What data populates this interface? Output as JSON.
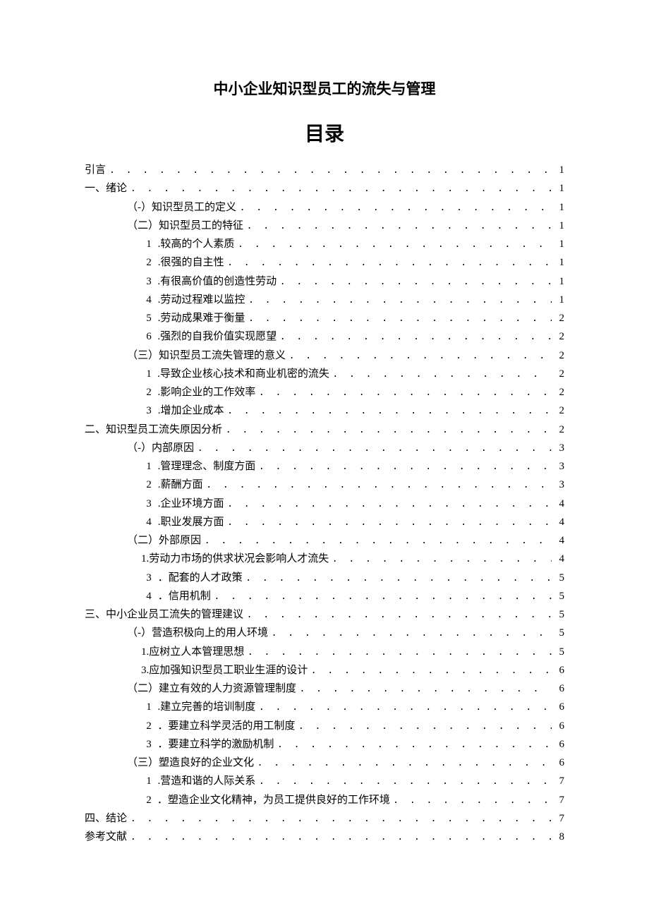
{
  "title": "中小企业知识型员工的流失与管理",
  "toc_heading": "目录",
  "entries": [
    {
      "indent": 0,
      "num": "",
      "label": "引言",
      "page": "1"
    },
    {
      "indent": 0,
      "num": "",
      "label": "一、绪论",
      "page": "1"
    },
    {
      "indent": 1,
      "num": "",
      "label": "（-）知识型员工的定义",
      "page": "1"
    },
    {
      "indent": 1,
      "num": "",
      "label": "（二）知识型员工的特征",
      "page": "1"
    },
    {
      "indent": 2,
      "num": "1",
      "label": ".较高的个人素质",
      "page": "1"
    },
    {
      "indent": 2,
      "num": "2",
      "label": ".很强的自主性",
      "page": "1"
    },
    {
      "indent": 2,
      "num": "3",
      "label": ".有很高价值的创造性劳动",
      "page": "1"
    },
    {
      "indent": 2,
      "num": "4",
      "label": ".劳动过程难以监控",
      "page": "1"
    },
    {
      "indent": 2,
      "num": "5",
      "label": ".劳动成果难于衡量",
      "page": "2"
    },
    {
      "indent": 2,
      "num": "6",
      "label": ".强烈的自我价值实现愿望",
      "page": "2"
    },
    {
      "indent": 1,
      "num": "",
      "label": "（三）知识型员工流失管理的意义",
      "page": "2"
    },
    {
      "indent": 2,
      "num": "1",
      "label": ".导致企业核心技术和商业机密的流失",
      "page": "2"
    },
    {
      "indent": 2,
      "num": "2",
      "label": ".影响企业的工作效率",
      "page": "2"
    },
    {
      "indent": 2,
      "num": "3",
      "label": ".增加企业成本",
      "page": "2"
    },
    {
      "indent": 0,
      "num": "",
      "label": "二、知识型员工流失原因分析",
      "page": "2"
    },
    {
      "indent": 1,
      "num": "",
      "label": "（-）内部原因",
      "page": "3"
    },
    {
      "indent": 2,
      "num": "1",
      "label": ".管理理念、制度方面",
      "page": "3"
    },
    {
      "indent": 2,
      "num": "2",
      "label": ".薪酬方面",
      "page": "3"
    },
    {
      "indent": 2,
      "num": "3",
      "label": ".企业环境方面",
      "page": "4"
    },
    {
      "indent": 2,
      "num": "4",
      "label": ".职业发展方面",
      "page": "4"
    },
    {
      "indent": 1,
      "num": "",
      "label": "（二）外部原因",
      "page": "4"
    },
    {
      "indent": 2,
      "num": "",
      "label": "1.劳动力市场的供求状况会影响人才流失",
      "page": "4"
    },
    {
      "indent": 2,
      "num": "3",
      "label": "．配套的人才政策",
      "page": "5"
    },
    {
      "indent": 2,
      "num": "4",
      "label": "．信用机制",
      "page": "5"
    },
    {
      "indent": 0,
      "num": "",
      "label": "三、中小企业员工流失的管理建议",
      "page": "5"
    },
    {
      "indent": 1,
      "num": "",
      "label": "（-）营造积极向上的用人环境",
      "page": "5"
    },
    {
      "indent": 2,
      "num": "",
      "label": "1.应树立人本管理思想",
      "page": "5"
    },
    {
      "indent": 2,
      "num": "",
      "label": "3.应加强知识型员工职业生涯的设计",
      "page": "6"
    },
    {
      "indent": 1,
      "num": "",
      "label": "（二）建立有效的人力资源管理制度",
      "page": "6"
    },
    {
      "indent": 2,
      "num": "1",
      "label": ".建立完善的培训制度",
      "page": "6"
    },
    {
      "indent": 2,
      "num": "2",
      "label": "．要建立科学灵活的用工制度",
      "page": "6"
    },
    {
      "indent": 2,
      "num": "3",
      "label": "．要建立科学的激励机制",
      "page": "6"
    },
    {
      "indent": 1,
      "num": "",
      "label": "（三）塑造良好的企业文化",
      "page": "6"
    },
    {
      "indent": 2,
      "num": "1",
      "label": ".营造和谐的人际关系",
      "page": "7"
    },
    {
      "indent": 2,
      "num": "2",
      "label": "．塑造企业文化精神，为员工提供良好的工作环境",
      "page": "7"
    },
    {
      "indent": 0,
      "num": "",
      "label": "四、结论",
      "page": "7"
    },
    {
      "indent": 0,
      "num": "",
      "label": "参考文献",
      "page": "8"
    }
  ]
}
